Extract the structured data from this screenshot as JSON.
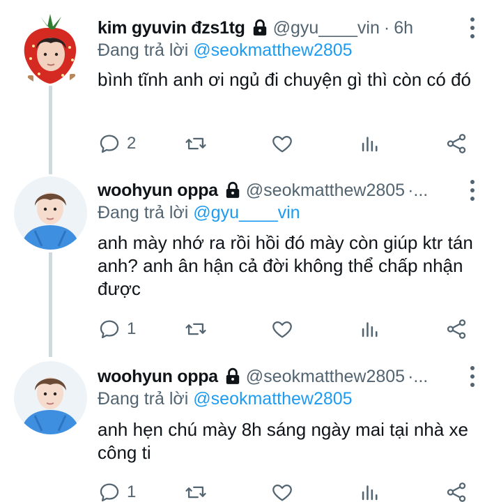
{
  "replying_label": "Đang trả lời",
  "colors": {
    "text": "#0f1419",
    "secondary": "#536471",
    "link": "#1d9bf0",
    "thread_line": "#cfd9de"
  },
  "tweets": [
    {
      "display_name": "kim gyuvin đzs1tg",
      "handle": "@gyu____vin",
      "time": "6h",
      "replying_to": "@seokmatthew2805",
      "text": "bình tĩnh anh ơi ngủ đi chuyện gì thì còn có đó",
      "reply_count": "2",
      "avatar_icon": "strawberry-avatar"
    },
    {
      "display_name": "woohyun oppa",
      "handle": "@seokmatthew2805",
      "time": "·...",
      "replying_to": "@gyu____vin",
      "text": "anh mày nhớ ra rồi hồi đó mày còn giúp ktr tán anh? anh ân hận cả đời không thể chấp nhận được",
      "reply_count": "1",
      "avatar_icon": "boy-blue-hoodie-avatar"
    },
    {
      "display_name": "woohyun oppa",
      "handle": "@seokmatthew2805",
      "time": "·...",
      "replying_to": "@seokmatthew2805",
      "text": "anh hẹn chú mày 8h sáng ngày mai tại nhà xe công ti",
      "reply_count": "1",
      "avatar_icon": "boy-blue-hoodie-avatar"
    }
  ]
}
